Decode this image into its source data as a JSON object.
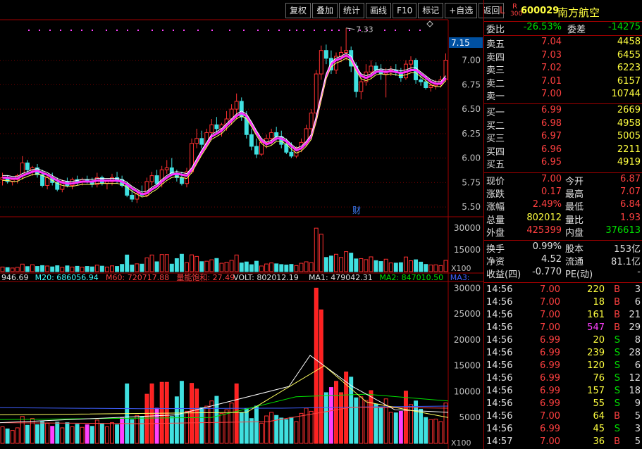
{
  "toolbar": [
    {
      "label": "复权",
      "icon": ""
    },
    {
      "label": "叠加",
      "icon": ""
    },
    {
      "label": "统计",
      "icon": ""
    },
    {
      "label": "画线",
      "icon": ""
    },
    {
      "label": "F10",
      "icon": ""
    },
    {
      "label": "标记",
      "icon": ""
    },
    {
      "label": "+自选",
      "icon": ""
    },
    {
      "label": "返回",
      "icon": ""
    }
  ],
  "stock": {
    "flag": "L",
    "rz_top": "R",
    "rz_bot": "300",
    "code": "600029",
    "name": "南方航空"
  },
  "price_axis": {
    "labels": [
      "7.00",
      "6.75",
      "6.50",
      "6.25",
      "6.00",
      "5.75",
      "5.50"
    ],
    "current": "7.15",
    "max_label": "7.33"
  },
  "volume_axis": {
    "labels": [
      "30000",
      "15000"
    ],
    "unit": "X100"
  },
  "lower_axis": {
    "labels": [
      "30000",
      "25000",
      "20000",
      "15000",
      "10000",
      "5000"
    ],
    "unit": "X100"
  },
  "indicator_line": [
    {
      "text": "946.69",
      "color": "#e0e0e0"
    },
    {
      "text": "M20: 686056.94",
      "color": "#40ffff"
    },
    {
      "text": "M60: 720717.88",
      "color": "#ff4040"
    },
    {
      "text": "量能饱和: 27.49",
      "color": "#ff4040"
    },
    {
      "text": "VOLT: 802012.19",
      "color": "#e0e0e0"
    },
    {
      "text": "MA1: 479042.31",
      "color": "#e0e0e0"
    },
    {
      "text": "MA2: 847010.50",
      "color": "#00e000"
    },
    {
      "text": "MA3:",
      "color": "#4060ff"
    }
  ],
  "cai_label": "财",
  "weibi": {
    "l1": "委比",
    "v1": "-26.53%",
    "l2": "委差",
    "v2": "-14275"
  },
  "asks": [
    {
      "label": "卖五",
      "price": "7.04",
      "vol": "4458"
    },
    {
      "label": "卖四",
      "price": "7.03",
      "vol": "6455"
    },
    {
      "label": "卖三",
      "price": "7.02",
      "vol": "6223"
    },
    {
      "label": "卖二",
      "price": "7.01",
      "vol": "6157"
    },
    {
      "label": "卖一",
      "price": "7.00",
      "vol": "10744"
    }
  ],
  "bids": [
    {
      "label": "买一",
      "price": "6.99",
      "vol": "2669"
    },
    {
      "label": "买二",
      "price": "6.98",
      "vol": "4958"
    },
    {
      "label": "买三",
      "price": "6.97",
      "vol": "5005"
    },
    {
      "label": "买四",
      "price": "6.96",
      "vol": "2211"
    },
    {
      "label": "买五",
      "price": "6.95",
      "vol": "4919"
    }
  ],
  "quote": [
    {
      "l1": "现价",
      "v1": "7.00",
      "c1": "red",
      "l2": "今开",
      "v2": "6.87",
      "c2": "red"
    },
    {
      "l1": "涨跌",
      "v1": "0.17",
      "c1": "red",
      "l2": "最高",
      "v2": "7.07",
      "c2": "red"
    },
    {
      "l1": "涨幅",
      "v1": "2.49%",
      "c1": "red",
      "l2": "最低",
      "v2": "6.84",
      "c2": "red"
    },
    {
      "l1": "总量",
      "v1": "802012",
      "c1": "yel",
      "l2": "量比",
      "v2": "1.93",
      "c2": "red"
    },
    {
      "l1": "外盘",
      "v1": "425399",
      "c1": "red",
      "l2": "内盘",
      "v2": "376613",
      "c2": "green"
    }
  ],
  "fund": [
    {
      "l1": "换手",
      "v1": "0.99%",
      "l2": "股本",
      "v2": "153亿"
    },
    {
      "l1": "净资",
      "v1": "4.52",
      "l2": "流通",
      "v2": "81.1亿"
    },
    {
      "l1": "收益(四)",
      "v1": "-0.770",
      "l2": "PE(动)",
      "v2": "-"
    }
  ],
  "ticks": [
    {
      "time": "14:56",
      "price": "7.00",
      "vol": "220",
      "side": "B",
      "n": "3"
    },
    {
      "time": "14:56",
      "price": "7.00",
      "vol": "18",
      "side": "B",
      "n": "6"
    },
    {
      "time": "14:56",
      "price": "7.00",
      "vol": "161",
      "side": "B",
      "n": "21"
    },
    {
      "time": "14:56",
      "price": "7.00",
      "vol": "547",
      "side": "B",
      "n": "29"
    },
    {
      "time": "14:56",
      "price": "6.99",
      "vol": "20",
      "side": "S",
      "n": "8"
    },
    {
      "time": "14:56",
      "price": "6.99",
      "vol": "239",
      "side": "S",
      "n": "28"
    },
    {
      "time": "14:56",
      "price": "6.99",
      "vol": "120",
      "side": "S",
      "n": "6"
    },
    {
      "time": "14:56",
      "price": "6.99",
      "vol": "76",
      "side": "S",
      "n": "12"
    },
    {
      "time": "14:56",
      "price": "6.99",
      "vol": "157",
      "side": "S",
      "n": "18"
    },
    {
      "time": "14:56",
      "price": "6.99",
      "vol": "55",
      "side": "S",
      "n": "9"
    },
    {
      "time": "14:56",
      "price": "7.00",
      "vol": "64",
      "side": "B",
      "n": "5"
    },
    {
      "time": "14:56",
      "price": "6.99",
      "vol": "45",
      "side": "S",
      "n": "3"
    },
    {
      "time": "14:57",
      "price": "7.00",
      "vol": "36",
      "side": "B",
      "n": "5"
    }
  ],
  "colors": {
    "up": "#ff3030",
    "down": "#40e0e0",
    "ma": "#ff30ff",
    "grid": "#a00000"
  },
  "chart_data": {
    "type": "candlestick",
    "ohlc": [
      [
        5.78,
        5.85,
        5.72,
        5.8
      ],
      [
        5.8,
        5.82,
        5.74,
        5.76
      ],
      [
        5.76,
        5.8,
        5.72,
        5.78
      ],
      [
        5.78,
        5.84,
        5.74,
        5.82
      ],
      [
        5.82,
        6.02,
        5.78,
        5.95
      ],
      [
        5.95,
        5.98,
        5.85,
        5.88
      ],
      [
        5.88,
        5.92,
        5.82,
        5.9
      ],
      [
        5.9,
        5.94,
        5.8,
        5.83
      ],
      [
        5.83,
        5.88,
        5.7,
        5.72
      ],
      [
        5.72,
        5.82,
        5.68,
        5.8
      ],
      [
        5.8,
        5.85,
        5.72,
        5.75
      ],
      [
        5.75,
        5.8,
        5.66,
        5.68
      ],
      [
        5.68,
        5.78,
        5.65,
        5.76
      ],
      [
        5.76,
        5.8,
        5.7,
        5.72
      ],
      [
        5.72,
        5.8,
        5.68,
        5.78
      ],
      [
        5.78,
        5.82,
        5.72,
        5.76
      ],
      [
        5.76,
        5.8,
        5.72,
        5.78
      ],
      [
        5.78,
        5.82,
        5.74,
        5.76
      ],
      [
        5.76,
        5.8,
        5.7,
        5.73
      ],
      [
        5.73,
        5.85,
        5.7,
        5.8
      ],
      [
        5.8,
        5.82,
        5.72,
        5.74
      ],
      [
        5.74,
        5.78,
        5.68,
        5.76
      ],
      [
        5.76,
        5.84,
        5.72,
        5.8
      ],
      [
        5.8,
        5.86,
        5.74,
        5.78
      ],
      [
        5.78,
        5.82,
        5.7,
        5.72
      ],
      [
        5.72,
        5.76,
        5.6,
        5.62
      ],
      [
        5.62,
        5.7,
        5.55,
        5.58
      ],
      [
        5.58,
        5.66,
        5.54,
        5.64
      ],
      [
        5.64,
        5.72,
        5.6,
        5.62
      ],
      [
        5.62,
        5.8,
        5.6,
        5.76
      ],
      [
        5.76,
        5.86,
        5.72,
        5.82
      ],
      [
        5.82,
        5.88,
        5.7,
        5.74
      ],
      [
        5.74,
        5.92,
        5.7,
        5.88
      ],
      [
        5.88,
        5.98,
        5.84,
        5.9
      ],
      [
        5.9,
        6.0,
        5.82,
        5.84
      ],
      [
        5.84,
        5.88,
        5.76,
        5.8
      ],
      [
        5.8,
        5.86,
        5.72,
        5.74
      ],
      [
        5.74,
        5.9,
        5.7,
        5.86
      ],
      [
        5.86,
        6.2,
        5.84,
        6.15
      ],
      [
        6.15,
        6.3,
        6.1,
        6.2
      ],
      [
        6.2,
        6.28,
        6.1,
        6.14
      ],
      [
        6.14,
        6.3,
        6.1,
        6.26
      ],
      [
        6.26,
        6.4,
        6.2,
        6.34
      ],
      [
        6.34,
        6.42,
        6.26,
        6.3
      ],
      [
        6.3,
        6.36,
        6.22,
        6.34
      ],
      [
        6.34,
        6.48,
        6.28,
        6.4
      ],
      [
        6.4,
        6.55,
        6.34,
        6.5
      ],
      [
        6.5,
        6.66,
        6.4,
        6.58
      ],
      [
        6.58,
        6.62,
        6.38,
        6.42
      ],
      [
        6.42,
        6.48,
        6.2,
        6.24
      ],
      [
        6.24,
        6.3,
        6.08,
        6.12
      ],
      [
        6.12,
        6.2,
        6.0,
        6.04
      ],
      [
        6.04,
        6.18,
        6.02,
        6.16
      ],
      [
        6.16,
        6.24,
        6.1,
        6.2
      ],
      [
        6.2,
        6.3,
        6.14,
        6.26
      ],
      [
        6.26,
        6.32,
        6.18,
        6.22
      ],
      [
        6.22,
        6.28,
        6.1,
        6.14
      ],
      [
        6.14,
        6.2,
        6.04,
        6.06
      ],
      [
        6.06,
        6.16,
        6.0,
        6.02
      ],
      [
        6.02,
        6.12,
        6.0,
        6.1
      ],
      [
        6.1,
        6.2,
        6.06,
        6.16
      ],
      [
        6.16,
        6.34,
        6.12,
        6.3
      ],
      [
        6.3,
        6.5,
        6.26,
        6.46
      ],
      [
        6.46,
        6.9,
        6.44,
        6.86
      ],
      [
        6.86,
        7.15,
        6.8,
        7.1
      ],
      [
        7.1,
        7.16,
        6.96,
        7.02
      ],
      [
        7.02,
        7.1,
        6.86,
        6.9
      ],
      [
        6.9,
        7.08,
        6.86,
        7.04
      ],
      [
        7.04,
        7.14,
        6.98,
        7.08
      ],
      [
        7.08,
        7.33,
        7.0,
        7.1
      ],
      [
        7.1,
        7.14,
        6.88,
        6.94
      ],
      [
        6.94,
        6.98,
        6.62,
        6.68
      ],
      [
        6.68,
        6.82,
        6.6,
        6.78
      ],
      [
        6.78,
        6.96,
        6.74,
        6.88
      ],
      [
        6.88,
        7.0,
        6.82,
        6.94
      ],
      [
        6.94,
        6.98,
        6.86,
        6.9
      ],
      [
        6.9,
        6.96,
        6.8,
        6.86
      ],
      [
        6.86,
        6.92,
        6.62,
        6.88
      ],
      [
        6.88,
        6.94,
        6.84,
        6.9
      ],
      [
        6.9,
        6.96,
        6.84,
        6.88
      ],
      [
        6.88,
        6.92,
        6.78,
        6.82
      ],
      [
        6.82,
        7.0,
        6.8,
        6.96
      ],
      [
        6.96,
        7.04,
        6.88,
        7.0
      ],
      [
        7.0,
        7.02,
        6.76,
        6.8
      ],
      [
        6.8,
        6.86,
        6.74,
        6.78
      ],
      [
        6.78,
        6.84,
        6.7,
        6.72
      ],
      [
        6.72,
        6.78,
        6.68,
        6.74
      ],
      [
        6.74,
        6.8,
        6.7,
        6.76
      ],
      [
        6.76,
        6.84,
        6.72,
        6.8
      ],
      [
        6.8,
        7.07,
        6.78,
        7.0
      ]
    ],
    "volume": [
      3200,
      2800,
      2500,
      3000,
      5200,
      3500,
      4800,
      3600,
      4200,
      3900,
      3300,
      4100,
      3000,
      4000,
      3200,
      3700,
      3100,
      3600,
      3300,
      4500,
      3800,
      3200,
      4000,
      3600,
      5000,
      11500,
      4600,
      5400,
      5200,
      9500,
      11500,
      6800,
      11800,
      11800,
      5200,
      9000,
      12000,
      6200,
      11600,
      10500,
      6900,
      7200,
      8200,
      9100,
      5800,
      6500,
      7800,
      11500,
      6000,
      6700,
      4800,
      7200,
      3900,
      5300,
      6000,
      5400,
      4900,
      4600,
      5000,
      4200,
      5800,
      6800,
      6200,
      30000,
      25800,
      9800,
      10800,
      12000,
      9800,
      13800,
      12800,
      8800,
      9000,
      8300,
      10200,
      7600,
      7000,
      8600,
      6000,
      5900,
      6200,
      10100,
      7500,
      8200,
      6600,
      5000,
      4600,
      4700,
      4200,
      7800
    ],
    "ma_daily": [
      5.8,
      5.8,
      5.79,
      5.79,
      5.82,
      5.84,
      5.86,
      5.87,
      5.85,
      5.83,
      5.8,
      5.77,
      5.75,
      5.74,
      5.74,
      5.75,
      5.76,
      5.76,
      5.76,
      5.77,
      5.77,
      5.77,
      5.77,
      5.77,
      5.76,
      5.73,
      5.69,
      5.66,
      5.63,
      5.64,
      5.68,
      5.71,
      5.76,
      5.8,
      5.83,
      5.84,
      5.83,
      5.82,
      5.88,
      5.97,
      6.06,
      6.14,
      6.22,
      6.25,
      6.28,
      6.33,
      6.38,
      6.43,
      6.46,
      6.43,
      6.35,
      6.26,
      6.18,
      6.14,
      6.16,
      6.2,
      6.2,
      6.17,
      6.12,
      6.08,
      6.1,
      6.15,
      6.22,
      6.4,
      6.62,
      6.84,
      6.96,
      7.0,
      7.02,
      7.05,
      7.02,
      6.92,
      6.84,
      6.82,
      6.84,
      6.88,
      6.89,
      6.88,
      6.89,
      6.88,
      6.87,
      6.88,
      6.9,
      6.9,
      6.86,
      6.82,
      6.78,
      6.76,
      6.76,
      6.82
    ]
  }
}
